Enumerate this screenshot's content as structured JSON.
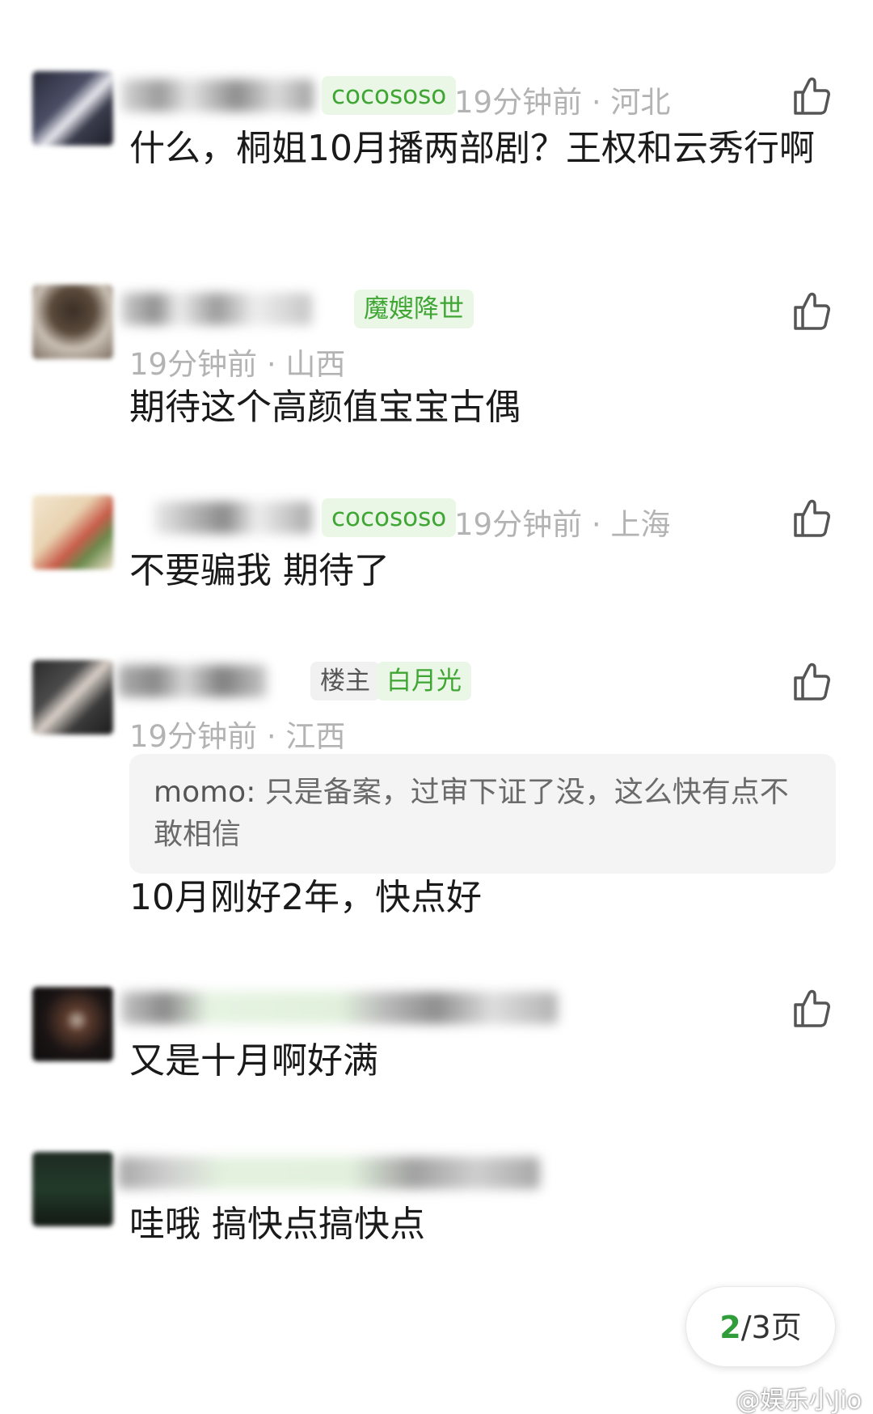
{
  "comments": [
    {
      "badge": "cocososo",
      "meta": "19分钟前 · 河北",
      "text": "什么，桐姐10月播两部剧？王权和云秀行啊"
    },
    {
      "badge": "魔嫂降世",
      "meta": "19分钟前 · 山西",
      "text": "期待这个高颜值宝宝古偶"
    },
    {
      "badge": "cocososo",
      "meta": "19分钟前 · 上海",
      "text": "不要骗我 期待了"
    },
    {
      "owner_badge": "楼主",
      "badge": "白月光",
      "meta": "19分钟前 · 江西",
      "quote_name": "momo:",
      "quote_text": " 只是备案，过审下证了没，这么快有点不敢相信",
      "text": "10月刚好2年，快点好"
    },
    {
      "text": "又是十月啊好满"
    },
    {
      "text": "哇哦 搞快点搞快点"
    }
  ],
  "pager": {
    "current": "2",
    "total": "/3页"
  },
  "watermark": "@娱乐小Jio",
  "icons": {
    "like": "thumbs-up-icon"
  },
  "colors": {
    "accent_green": "#3fa634",
    "badge_bg": "#eaf6e6",
    "meta_gray": "#b3b3b3"
  }
}
